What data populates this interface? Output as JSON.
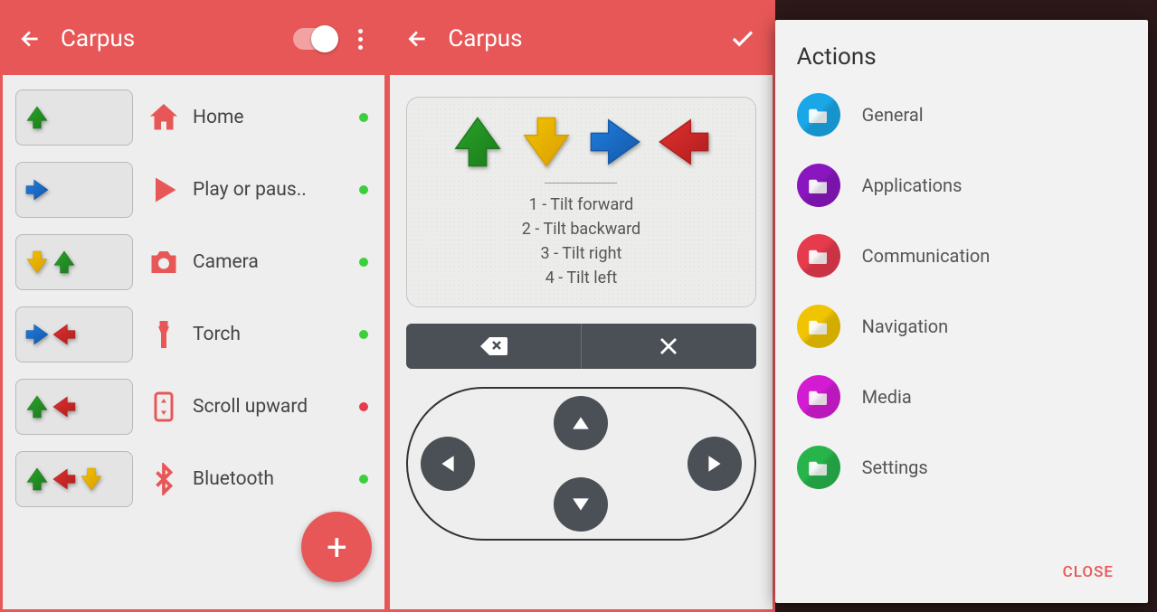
{
  "app_name": "Carpus",
  "panel1": {
    "rows": [
      {
        "arrows": [
          "green-up"
        ],
        "icon": "home",
        "label": "Home",
        "status": "green"
      },
      {
        "arrows": [
          "blue-right"
        ],
        "icon": "play",
        "label": "Play or paus..",
        "status": "green"
      },
      {
        "arrows": [
          "yellow-down",
          "green-up"
        ],
        "icon": "camera",
        "label": "Camera",
        "status": "green"
      },
      {
        "arrows": [
          "blue-right",
          "red-left"
        ],
        "icon": "torch",
        "label": "Torch",
        "status": "green"
      },
      {
        "arrows": [
          "green-up",
          "red-left"
        ],
        "icon": "scroll",
        "label": "Scroll upward",
        "status": "red"
      },
      {
        "arrows": [
          "green-up",
          "red-left",
          "yellow-down"
        ],
        "icon": "bluetooth",
        "label": "Bluetooth",
        "status": "green"
      }
    ]
  },
  "panel2": {
    "tilt": [
      "1 - Tilt forward",
      "2 - Tilt backward",
      "3 - Tilt right",
      "4 - Tilt left"
    ]
  },
  "dialog": {
    "title": "Actions",
    "categories": [
      {
        "label": "General",
        "color": "#1aa7e8"
      },
      {
        "label": "Applications",
        "color": "#8a16c0"
      },
      {
        "label": "Communication",
        "color": "#e63a4d"
      },
      {
        "label": "Navigation",
        "color": "#f0c400"
      },
      {
        "label": "Media",
        "color": "#d41bd4"
      },
      {
        "label": "Settings",
        "color": "#27b54b"
      }
    ],
    "close": "CLOSE"
  }
}
